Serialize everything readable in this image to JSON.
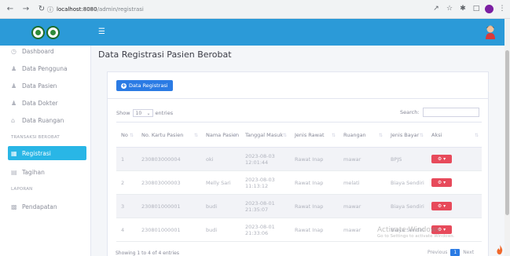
{
  "browser": {
    "url_host": "localhost:8080",
    "url_path": "/admin/registrasi"
  },
  "sidebar": {
    "items": [
      {
        "label": "Dashboard",
        "icon": "dashboard-icon"
      },
      {
        "label": "Data Pengguna",
        "icon": "user-icon"
      },
      {
        "label": "Data Pasien",
        "icon": "user-icon"
      },
      {
        "label": "Data Dokter",
        "icon": "user-icon"
      },
      {
        "label": "Data Ruangan",
        "icon": "home-icon"
      }
    ],
    "section_transaksi": "TRANSAKSI BEROBAT",
    "item_registrasi": "Registrasi",
    "item_tagihan": "Tagihan",
    "section_laporan": "LAPORAN",
    "item_pendapatan": "Pendapatan"
  },
  "page": {
    "title": "Data Registrasi Pasien Berobat",
    "add_button": "Data Registrasi",
    "show_label": "Show",
    "show_value": "10",
    "entries_label": "entries",
    "search_label": "Search:"
  },
  "table": {
    "headers": [
      "No",
      "No. Kartu Pasien",
      "Nama Pasien",
      "Tanggal Masuk",
      "Jenis Rawat",
      "Ruangan",
      "Jenis Bayar",
      "Aksi"
    ],
    "rows": [
      [
        "1",
        "230803000004",
        "oki",
        "2023-08-03 12:01:44",
        "Rawat Inap",
        "mawar",
        "BPJS"
      ],
      [
        "2",
        "230803000003",
        "Melly Sari",
        "2023-08-03 11:13:12",
        "Rawat Inap",
        "melati",
        "Biaya Sendiri"
      ],
      [
        "3",
        "230801000001",
        "budi",
        "2023-08-01 21:35:07",
        "Rawat Inap",
        "mawar",
        "Biaya Sendiri"
      ],
      [
        "4",
        "230801000001",
        "budi",
        "2023-08-01 21:33:06",
        "Rawat Inap",
        "mawar",
        "Biaya Sendiri"
      ]
    ]
  },
  "footer": {
    "info": "Showing 1 to 4 of 4 entries",
    "previous": "Previous",
    "page": "1",
    "next": "Next"
  },
  "watermark": {
    "line1": "Activate Windows",
    "line2": "Go to Settings to activate Windows."
  },
  "colors": {
    "topbar": "#2b9ad8",
    "active_item": "#29b6e6",
    "primary_button": "#2b7be4",
    "action_button": "#e74a5b"
  }
}
